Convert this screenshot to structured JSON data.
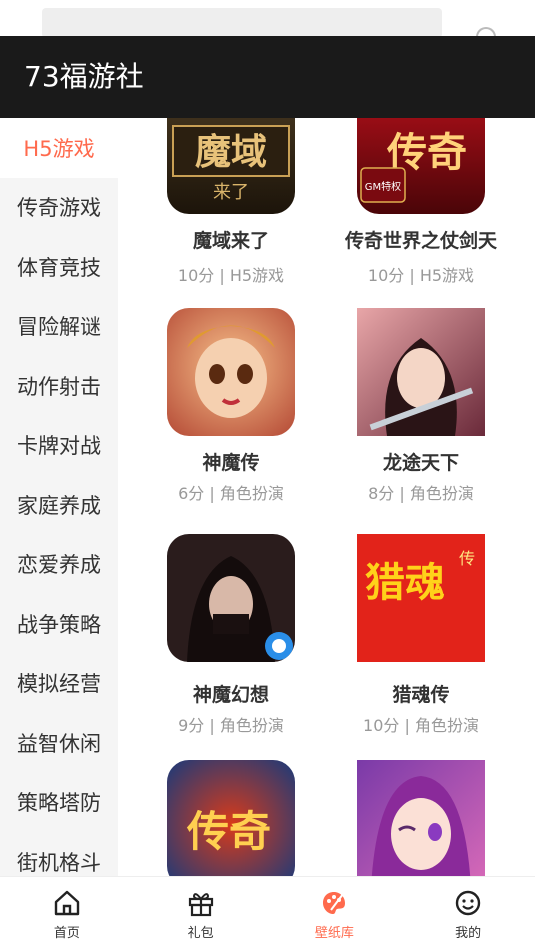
{
  "header": {
    "title": "73福游社"
  },
  "sidebar": {
    "items": [
      {
        "label": "H5游戏",
        "active": true
      },
      {
        "label": "传奇游戏"
      },
      {
        "label": "体育竞技"
      },
      {
        "label": "冒险解谜"
      },
      {
        "label": "动作射击"
      },
      {
        "label": "卡牌对战"
      },
      {
        "label": "家庭养成"
      },
      {
        "label": "恋爱养成"
      },
      {
        "label": "战争策略"
      },
      {
        "label": "模拟经营"
      },
      {
        "label": "益智休闲"
      },
      {
        "label": "策略塔防"
      },
      {
        "label": "街机格斗"
      }
    ]
  },
  "games": [
    {
      "title": "魔域来了",
      "meta": "10分 | H5游戏",
      "icon_text": "魔域",
      "icon_sub": "来了"
    },
    {
      "title": "传奇世界之仗剑天",
      "meta": "10分 | H5游戏",
      "icon_text": "传奇",
      "icon_sub": "GM特权"
    },
    {
      "title": "神魔传",
      "meta": "6分 | 角色扮演"
    },
    {
      "title": "龙途天下",
      "meta": "8分 | 角色扮演"
    },
    {
      "title": "神魔幻想",
      "meta": "9分 | 角色扮演"
    },
    {
      "title": "猎魂传",
      "meta": "10分 | 角色扮演",
      "icon_text": "猎魂",
      "icon_sub": "传"
    },
    {
      "title": "",
      "meta": "",
      "icon_text": "传奇"
    },
    {
      "title": "",
      "meta": ""
    }
  ],
  "bottom_nav": [
    {
      "label": "首页",
      "icon": "home-icon"
    },
    {
      "label": "礼包",
      "icon": "gift-icon"
    },
    {
      "label": "壁纸库",
      "icon": "palette-icon",
      "active": true
    },
    {
      "label": "我的",
      "icon": "smile-icon"
    }
  ],
  "colors": {
    "accent": "#ff6a4d",
    "header_bg": "#1a1a1a",
    "sidebar_bg": "#f5f5f5"
  }
}
